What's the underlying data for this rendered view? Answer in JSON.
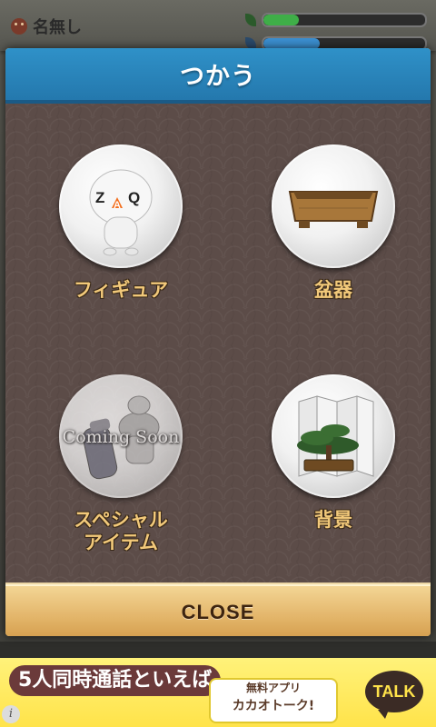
{
  "background": {
    "user_name": "名無し",
    "bars": [
      {
        "icon": "leaf-icon",
        "fill_fraction": 0.22,
        "color": "#3fae48"
      },
      {
        "icon": "water-icon",
        "fill_fraction": 0.35,
        "color": "#3b8fd0"
      }
    ]
  },
  "modal": {
    "title": "つかう",
    "items": [
      {
        "label": "フィギュア",
        "icon": "zaq-figure-icon",
        "enabled": true
      },
      {
        "label": "盆器",
        "icon": "bonsai-pot-icon",
        "enabled": true
      },
      {
        "label": "スペシャル\nアイテム",
        "icon": "special-item-icon",
        "enabled": false,
        "overlay": "Coming Soon"
      },
      {
        "label": "背景",
        "icon": "background-screen-icon",
        "enabled": true
      }
    ],
    "close_label": "CLOSE"
  },
  "ad": {
    "headline": "5人同時通話といえば",
    "sub_top": "無料アプリ",
    "sub_main": "カカオトーク!",
    "badge": "TALK",
    "info_icon": "info-icon",
    "info_glyph": "i"
  },
  "colors": {
    "header_blue": "#2478ad",
    "label_gold": "#f2c97a",
    "close_gold": "#e3b56a"
  }
}
